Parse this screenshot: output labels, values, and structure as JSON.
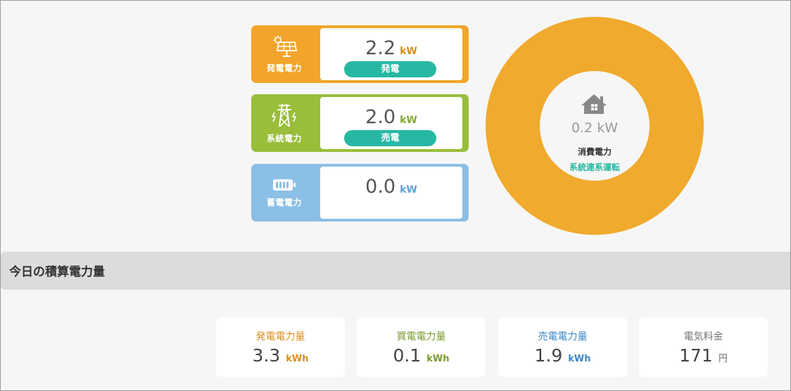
{
  "colors": {
    "solar": "#f2a52a",
    "grid": "#98be3a",
    "battery": "#8cbfe6",
    "donut": "#f0aa2e",
    "status": "#27b8a4"
  },
  "cards": [
    {
      "icon": "solar-panel-icon",
      "label": "発電電力",
      "value": "2.2",
      "unit": "kW",
      "status": "発電"
    },
    {
      "icon": "power-tower-icon",
      "label": "系統電力",
      "value": "2.0",
      "unit": "kW",
      "status": "売電"
    },
    {
      "icon": "battery-icon",
      "label": "蓄電電力",
      "value": "0.0",
      "unit": "kW",
      "status": ""
    }
  ],
  "consumption": {
    "icon": "house-icon",
    "value": "0.2 kW",
    "label": "消費電力",
    "status": "系統連系運転"
  },
  "section": {
    "title": "今日の積算電力量"
  },
  "totals": [
    {
      "label": "発電電力量",
      "value": "3.3",
      "unit": "kWh"
    },
    {
      "label": "買電電力量",
      "value": "0.1",
      "unit": "kWh"
    },
    {
      "label": "売電電力量",
      "value": "1.9",
      "unit": "kWh"
    },
    {
      "label": "電気料金",
      "value": "171",
      "unit": "円"
    }
  ]
}
